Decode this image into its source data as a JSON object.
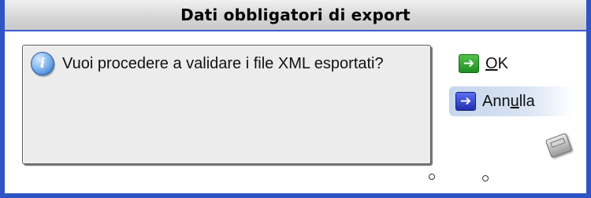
{
  "window": {
    "title": "Dati obbligatori di export"
  },
  "message": {
    "icon": "info-icon",
    "text": "Vuoi procedere a validare i file XML esportati?"
  },
  "buttons": {
    "ok": {
      "pre": "",
      "accel": "O",
      "post": "K",
      "icon": "arrow-right-icon"
    },
    "annulla": {
      "pre": "Ann",
      "accel": "u",
      "post": "lla",
      "icon": "arrow-right-icon"
    }
  },
  "colors": {
    "frame": "#2f54c6",
    "ok_icon": "#1e8f24",
    "annulla_icon": "#1f2fb0"
  }
}
